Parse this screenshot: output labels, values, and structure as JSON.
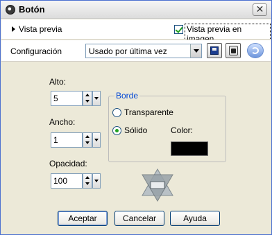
{
  "window": {
    "title": "Botón"
  },
  "preview": {
    "label": "Vista previa",
    "on_image_label": "Vista previa en imagen"
  },
  "config": {
    "label": "Configuración",
    "selected": "Usado por última vez"
  },
  "fields": {
    "height_label": "Alto:",
    "height_value": "5",
    "width_label": "Ancho:",
    "width_value": "1",
    "opacity_label": "Opacidad:",
    "opacity_value": "100"
  },
  "border": {
    "title": "Borde",
    "transparent_label": "Transparente",
    "solid_label": "Sólido",
    "color_label": "Color:",
    "color_value": "#000000"
  },
  "buttons": {
    "ok": "Aceptar",
    "cancel": "Cancelar",
    "help": "Ayuda"
  }
}
